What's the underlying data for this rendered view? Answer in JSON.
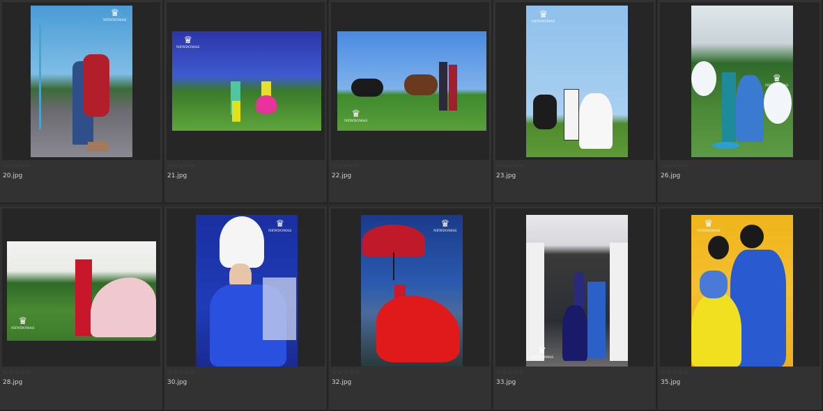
{
  "thumbnails": [
    {
      "filename": "20.jpg",
      "rating": "☆☆☆☆☆"
    },
    {
      "filename": "21.jpg",
      "rating": "☆☆☆☆☆"
    },
    {
      "filename": "22.jpg",
      "rating": "☆☆☆☆☆"
    },
    {
      "filename": "23.jpg",
      "rating": "☆☆☆☆☆"
    },
    {
      "filename": "26.jpg",
      "rating": "☆☆☆☆☆"
    },
    {
      "filename": "28.jpg",
      "rating": "☆☆☆☆☆"
    },
    {
      "filename": "30.jpg",
      "rating": "☆☆☆☆☆"
    },
    {
      "filename": "32.jpg",
      "rating": "☆☆☆☆☆"
    },
    {
      "filename": "33.jpg",
      "rating": "☆☆☆☆☆"
    },
    {
      "filename": "35.jpg",
      "rating": "☆☆☆☆☆"
    }
  ],
  "watermark": {
    "symbol": "♛",
    "text": "NEWDOMAS"
  },
  "colors": {
    "background": "#2b2b2b",
    "cell": "#323232",
    "filename_text": "#d4d4d4",
    "star": "#4a4a4a"
  }
}
